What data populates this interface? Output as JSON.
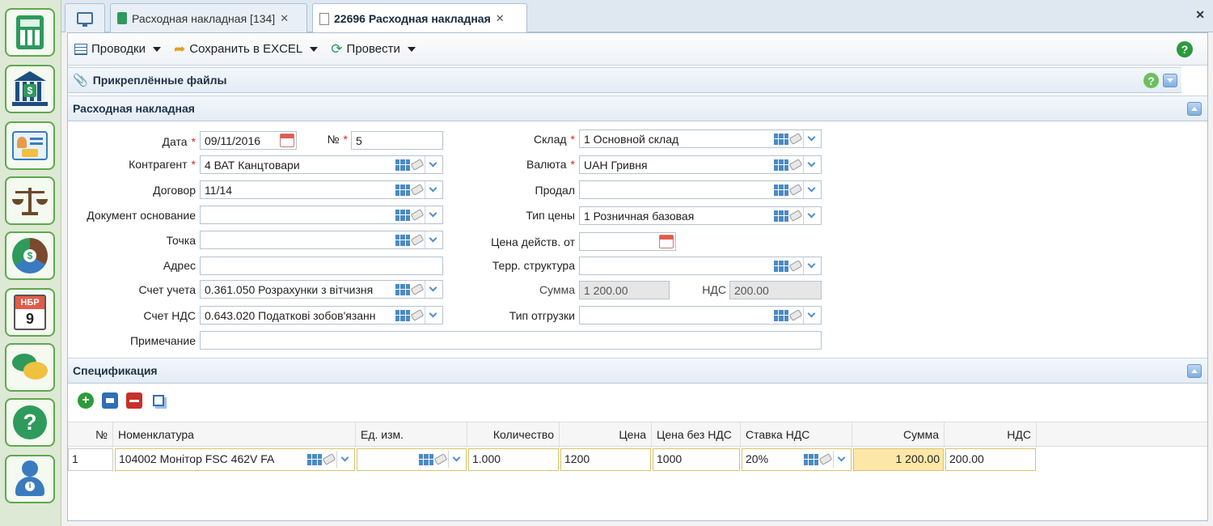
{
  "sidebar": {
    "items": [
      {
        "name": "calculator"
      },
      {
        "name": "bank"
      },
      {
        "name": "contacts"
      },
      {
        "name": "balance-scale"
      },
      {
        "name": "finance-chart"
      },
      {
        "name": "nbr-calendar",
        "badge_top": "НБР",
        "badge_num": "9"
      },
      {
        "name": "chat"
      },
      {
        "name": "help"
      },
      {
        "name": "user-info"
      }
    ]
  },
  "tabs": [
    {
      "label": ""
    },
    {
      "label": "Расходная накладная [134]"
    },
    {
      "label": "22696 Расходная накладная"
    }
  ],
  "toolbar": {
    "postings": "Проводки",
    "save_excel": "Сохранить в EXCEL",
    "post": "Провести"
  },
  "attached": {
    "title": "Прикреплённые файлы"
  },
  "invoice": {
    "title": "Расходная накладная",
    "date_label": "Дата",
    "date_value": "09/11/2016",
    "num_label": "№",
    "num_value": "5",
    "counterparty_label": "Контрагент",
    "counterparty_value": "4 ВАТ Канцтовари",
    "contract_label": "Договор",
    "contract_value": "11/14",
    "base_doc_label": "Документ основание",
    "base_doc_value": "",
    "point_label": "Точка",
    "point_value": "",
    "address_label": "Адрес",
    "address_value": "",
    "account_label": "Счет учета",
    "account_value": "0.361.050 Розрахунки з вітчизня",
    "vat_account_label": "Счет НДС",
    "vat_account_value": "0.643.020 Податкові зобов'язанн",
    "note_label": "Примечание",
    "note_value": "",
    "warehouse_label": "Склад",
    "warehouse_value": "1 Основной склад",
    "currency_label": "Валюта",
    "currency_value": "UAH Гривня",
    "sold_label": "Продал",
    "sold_value": "",
    "price_type_label": "Тип цены",
    "price_type_value": "1 Розничная базовая",
    "price_valid_label": "Цена действ. от",
    "price_valid_value": "",
    "terr_label": "Терр. структура",
    "terr_value": "",
    "sum_label": "Сумма",
    "sum_value": "1 200.00",
    "vat_label": "НДС",
    "vat_value": "200.00",
    "ship_type_label": "Тип отгрузки",
    "ship_type_value": ""
  },
  "spec": {
    "title": "Спецификация",
    "columns": [
      "№",
      "Номенклатура",
      "Ед. изм.",
      "Количество",
      "Цена",
      "Цена без НДС",
      "Ставка НДС",
      "Сумма",
      "НДС"
    ],
    "row": {
      "num": "1",
      "item": "104002 Монітор FSC 462V FA",
      "unit": "",
      "qty": "1.000",
      "price": "1200",
      "price_no_vat": "1000",
      "vat_rate": "20%",
      "sum": "1 200.00",
      "vat": "200.00"
    }
  },
  "colors": {
    "accent": "#5fa84f",
    "header": "#1f3346",
    "highlight": "#fde7a8"
  }
}
